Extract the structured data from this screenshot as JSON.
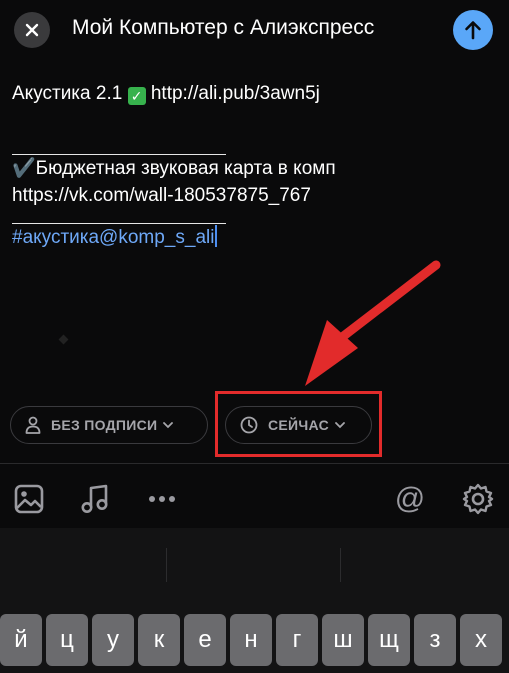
{
  "header": {
    "title": "Мой Компьютер с Алиэкспресс",
    "close_icon": "close-icon",
    "send_icon": "arrow-up-icon",
    "send_color": "#5aa7f8"
  },
  "post": {
    "line1_text": "Акустика 2.1",
    "line1_link": "http://ali.pub/3awn5j",
    "line2": "✔️Бюджетная звуковая карта в комп",
    "line3": "https://vk.com/wall-180537875_767",
    "hashtag": "#акустика@komp_s_ali"
  },
  "controls": {
    "signature_label": "БЕЗ ПОДПИСИ",
    "time_label": "СЕЙЧАС"
  },
  "annotation": {
    "highlight_color": "#e22b2b"
  },
  "toolbar": {
    "icons": [
      "image-icon",
      "music-icon",
      "more-icon",
      "mention-icon",
      "settings-icon"
    ],
    "mention": "@"
  },
  "keyboard": {
    "keys": [
      "й",
      "ц",
      "у",
      "к",
      "е",
      "н",
      "г",
      "ш",
      "щ",
      "з",
      "х"
    ]
  }
}
